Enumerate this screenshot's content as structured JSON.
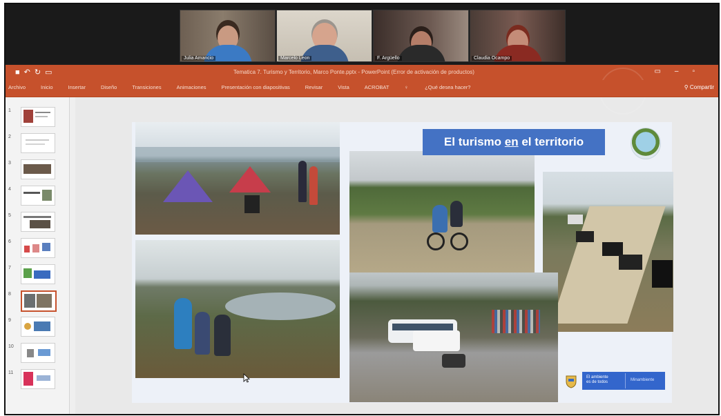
{
  "video_call": {
    "participants": [
      {
        "name": "Julia Amancio"
      },
      {
        "name": "Marcelo Leon"
      },
      {
        "name": "F. Argüello"
      },
      {
        "name": "Claudia Ocampo"
      }
    ]
  },
  "powerpoint": {
    "window_title": "Tematica 7. Turismo y Territorio, Marco Ponte.pptx - PowerPoint (Error de activación de productos)",
    "menu_items": [
      "Archivo",
      "Inicio",
      "Insertar",
      "Diseño",
      "Transiciones",
      "Animaciones",
      "Presentación con diapositivas",
      "Revisar",
      "Vista",
      "ACROBAT",
      "¿Qué desea hacer?"
    ],
    "share_label": "Compartir",
    "active_slide": 8,
    "thumbnails": [
      1,
      2,
      3,
      4,
      5,
      6,
      7,
      8,
      9,
      10,
      11
    ]
  },
  "slide": {
    "title_pre": "El turismo ",
    "title_link": "en",
    "title_post": " el territorio",
    "gov_badge_left_1": "El ambiente",
    "gov_badge_left_2": "es de todos",
    "gov_badge_right": "Minambiente"
  },
  "colors": {
    "ppt_accent": "#c6512c",
    "title_box": "#4472c4",
    "gov_badge": "#3366cc"
  }
}
